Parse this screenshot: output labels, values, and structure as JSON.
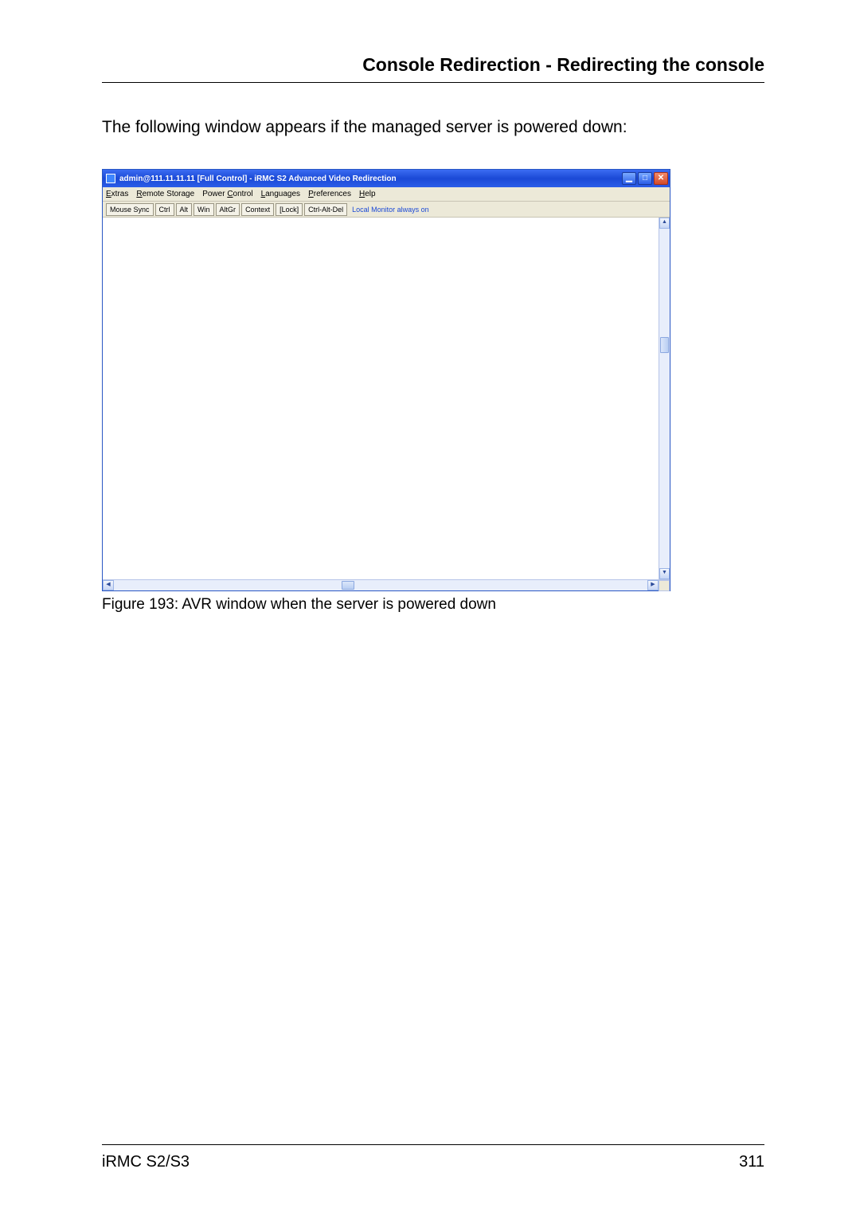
{
  "header": {
    "title": "Console Redirection - Redirecting the console"
  },
  "intro": "The following window appears if the managed server is powered down:",
  "window": {
    "title": "admin@111.11.11.11 [Full Control] - iRMC S2 Advanced Video Redirection",
    "menus": {
      "extras": "Extras",
      "remote_storage": "Remote Storage",
      "power_control": "Power Control",
      "languages": "Languages",
      "preferences": "Preferences",
      "help": "Help"
    },
    "toolbar": {
      "mouse_sync": "Mouse Sync",
      "ctrl": "Ctrl",
      "alt": "Alt",
      "win": "Win",
      "altgr": "AltGr",
      "context": "Context",
      "lock": "[Lock]",
      "cad": "Ctrl-Alt-Del",
      "status": "Local Monitor always on"
    },
    "controls": {
      "minimize": "▁",
      "maximize": "□",
      "close": "✕"
    }
  },
  "figure_caption": "Figure 193: AVR window when the server is powered down",
  "footer": {
    "left": "iRMC S2/S3",
    "right": "311"
  }
}
